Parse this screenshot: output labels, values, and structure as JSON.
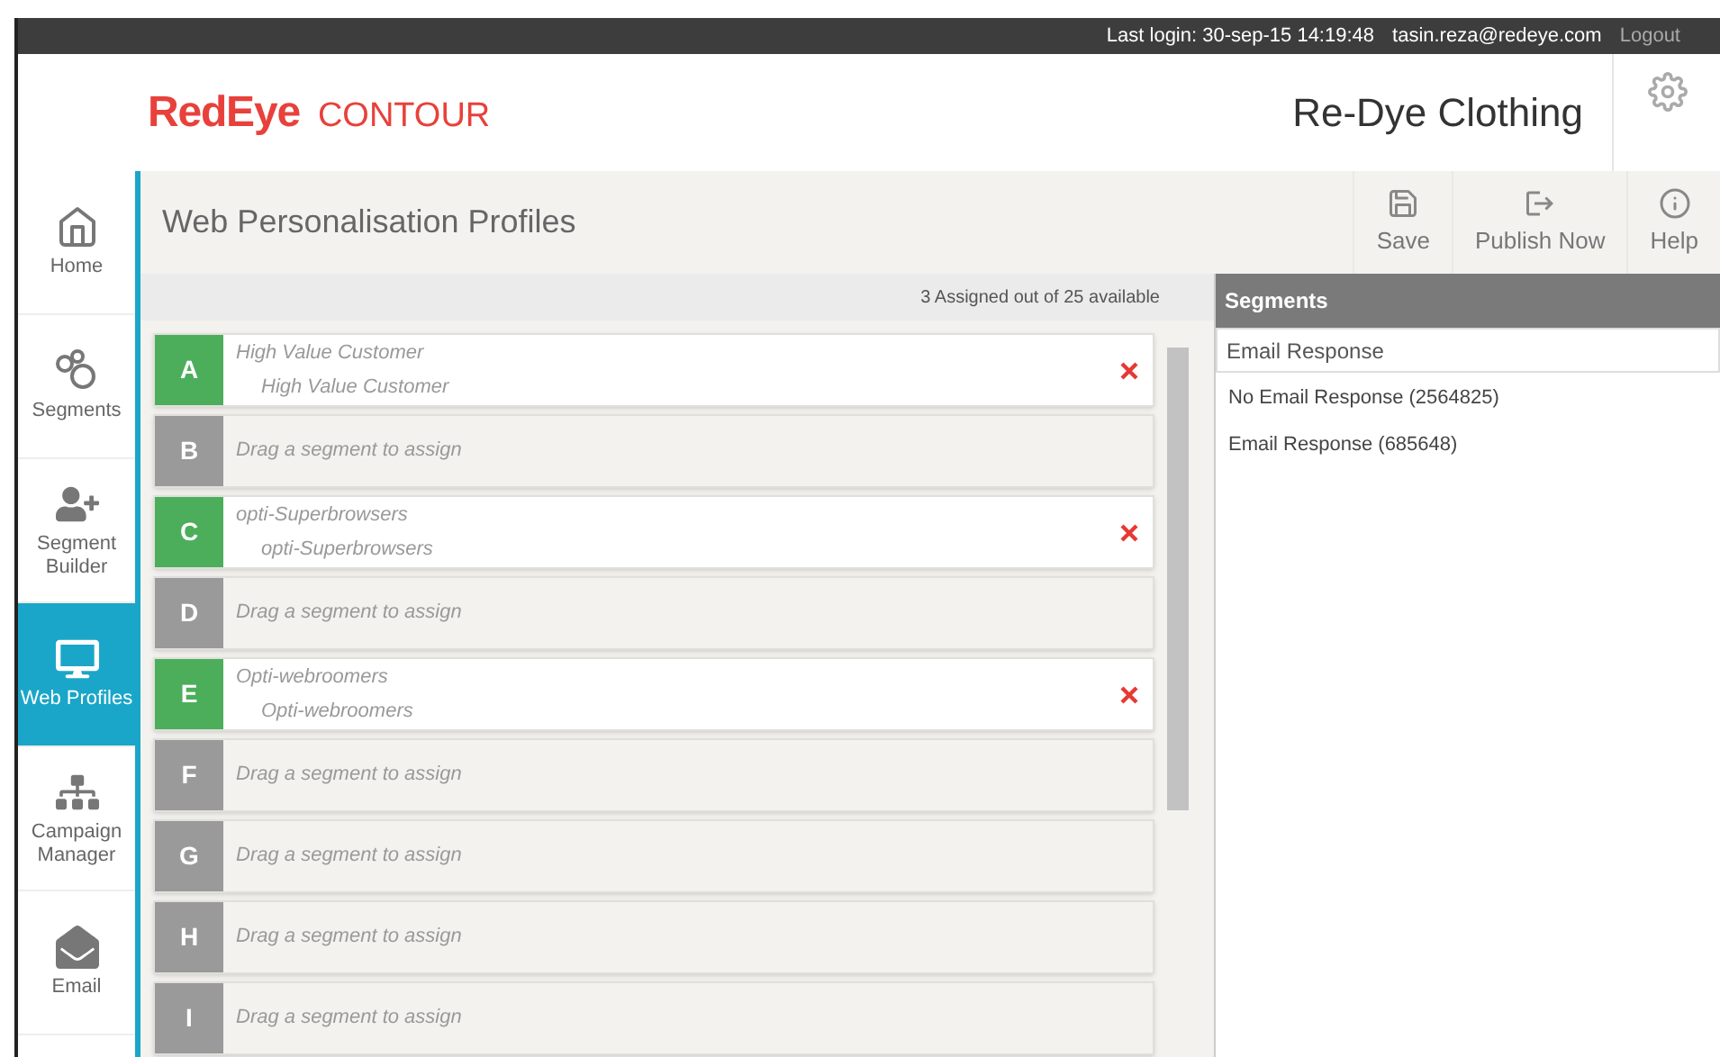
{
  "top_bar": {
    "last_login": "Last login: 30-sep-15 14:19:48",
    "user": "tasin.reza@redeye.com",
    "logout": "Logout"
  },
  "header": {
    "logo_brand": "RedEye",
    "logo_product": "CONTOUR",
    "client": "Re-Dye Clothing"
  },
  "sidebar": {
    "items": [
      {
        "label": "Home",
        "kind": "home",
        "selected": false
      },
      {
        "label": "Segments",
        "kind": "segments",
        "selected": false
      },
      {
        "label": "Segment Builder",
        "kind": "builder",
        "selected": false
      },
      {
        "label": "Web Profiles",
        "kind": "web",
        "selected": true
      },
      {
        "label": "Campaign Manager",
        "kind": "campaign",
        "selected": false
      },
      {
        "label": "Email",
        "kind": "email",
        "selected": false
      }
    ]
  },
  "page": {
    "title": "Web Personalisation Profiles",
    "toolbar": [
      {
        "label": "Save",
        "kind": "save"
      },
      {
        "label": "Publish Now",
        "kind": "publish"
      },
      {
        "label": "Help",
        "kind": "help"
      }
    ]
  },
  "profiles": {
    "summary": "3 Assigned out of 25 available",
    "slots": [
      {
        "letter": "A",
        "assigned": true,
        "title": "High Value Customer",
        "subtitle": "High Value Customer"
      },
      {
        "letter": "B",
        "assigned": false,
        "placeholder": "Drag a segment to assign"
      },
      {
        "letter": "C",
        "assigned": true,
        "title": "opti-Superbrowsers",
        "subtitle": "opti-Superbrowsers"
      },
      {
        "letter": "D",
        "assigned": false,
        "placeholder": "Drag a segment to assign"
      },
      {
        "letter": "E",
        "assigned": true,
        "title": "Opti-webroomers",
        "subtitle": "Opti-webroomers"
      },
      {
        "letter": "F",
        "assigned": false,
        "placeholder": "Drag a segment to assign"
      },
      {
        "letter": "G",
        "assigned": false,
        "placeholder": "Drag a segment to assign"
      },
      {
        "letter": "H",
        "assigned": false,
        "placeholder": "Drag a segment to assign"
      },
      {
        "letter": "I",
        "assigned": false,
        "placeholder": "Drag a segment to assign"
      }
    ]
  },
  "segments": {
    "title": "Segments",
    "search": {
      "value": "Email Response"
    },
    "items": [
      "No Email Response (2564825)",
      "Email Response (685648)"
    ]
  }
}
